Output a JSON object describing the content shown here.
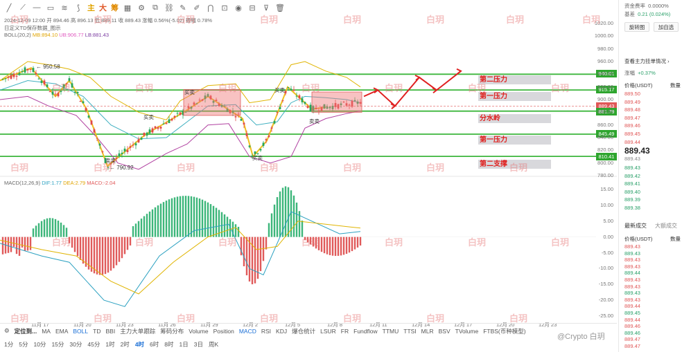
{
  "toolbar": {
    "labels": [
      "主",
      "大",
      "筹"
    ]
  },
  "chart_info": {
    "line1": "2024-12-09 12:00  开 894.46  高 896.13  低 889.11  收 889.43  涨幅 0.56%(-5.02)  振幅 0.78%",
    "line2": "日定义TD保存数据_图示",
    "boll_label": "BOLL(20,2)",
    "boll_mid": "MB:894.10",
    "boll_up": "UB:906.77",
    "boll_low": "LB:881.43",
    "macd_label": "MACD(12,26,9)",
    "macd_dif": "DIF:1.77",
    "macd_dea": "DEA:2.79",
    "macd_val": "MACD:-2.04"
  },
  "levels": [
    {
      "value": "940.01",
      "zone": "第二压力"
    },
    {
      "value": "915.17",
      "zone": "第一压力"
    },
    {
      "value": "889.43",
      "zone": ""
    },
    {
      "value": "881.79",
      "zone": "分水岭"
    },
    {
      "value": "845.49",
      "zone": "第一压力"
    },
    {
      "value": "810.41",
      "zone": "第二支撑"
    }
  ],
  "annotations": {
    "high_label": "950.58",
    "low_label": "790.92",
    "buy1": "卖卖",
    "buy2": "买卖",
    "buy3": "买卖",
    "buy4": "买卖",
    "buy5": "买卖",
    "buy6": "卖卖"
  },
  "y_axis": [
    "1020.00",
    "1000.00",
    "980.00",
    "960.00",
    "940.00",
    "920.00",
    "900.00",
    "880.00",
    "860.00",
    "840.00",
    "820.00",
    "800.00",
    "780.00"
  ],
  "macd_axis": [
    "15.00",
    "10.00",
    "5.00",
    "0.00",
    "-5.00",
    "-10.00",
    "-15.00",
    "-20.00",
    "-25.00"
  ],
  "x_axis": [
    "11月 17",
    "11月 20",
    "11月 23",
    "11月 26",
    "11月 29",
    "12月 2",
    "12月 5",
    "12月 8",
    "12月 11",
    "12月 14",
    "12月 17",
    "12月 20",
    "12月 23"
  ],
  "watermark_text": "白玥",
  "bottom": {
    "settings_label": "定位到...",
    "indicators": [
      "MA",
      "EMA",
      "BOLL",
      "TD",
      "BBI",
      "主力大单跟踪",
      "筹码分布",
      "Volume",
      "Position",
      "MACD",
      "RSI",
      "KDJ",
      "爆仓统计",
      "LSUR",
      "FR",
      "Fundflow",
      "TTMU",
      "TTSI",
      "MLR",
      "BSV",
      "TVolume",
      "FTBS(币种模型)"
    ],
    "intervals": [
      "1分",
      "5分",
      "10分",
      "15分",
      "30分",
      "45分",
      "1时",
      "2时",
      "4时",
      "6时",
      "8时",
      "1日",
      "3日",
      "周K"
    ],
    "brand": "@Crypto 白玥"
  },
  "right_panel": {
    "fund_rate_label": "资金费率",
    "fund_rate_value": "0.0000%",
    "basis_label": "基差",
    "basis_value": "0.21 (0.024%)",
    "btn_rotate": "旋转图",
    "btn_add": "加自选",
    "main_flow_label": "查看主力挂单情况",
    "change_label": "涨幅",
    "change_value": "+0.37%",
    "price_header": "价格(USDT)",
    "qty_header": "数量",
    "asks": [
      "889.50",
      "889.49",
      "889.48",
      "889.47",
      "889.46",
      "889.45",
      "889.44"
    ],
    "last_price": "889.43",
    "last_price_sub": "889.43",
    "bids": [
      "889.43",
      "889.42",
      "889.41",
      "889.40",
      "889.39",
      "889.38"
    ],
    "trades_tab": "最新成交",
    "bigtrades_tab": "大额成交",
    "trades_price_header": "价格(USDT)",
    "trades_qty_header": "数量",
    "trades": [
      "889.43",
      "889.43",
      "889.43",
      "889.43",
      "889.44",
      "889.43",
      "889.43",
      "889.43",
      "889.43",
      "889.44",
      "889.45",
      "889.44",
      "889.46",
      "889.46",
      "889.47",
      "889.47"
    ]
  }
}
